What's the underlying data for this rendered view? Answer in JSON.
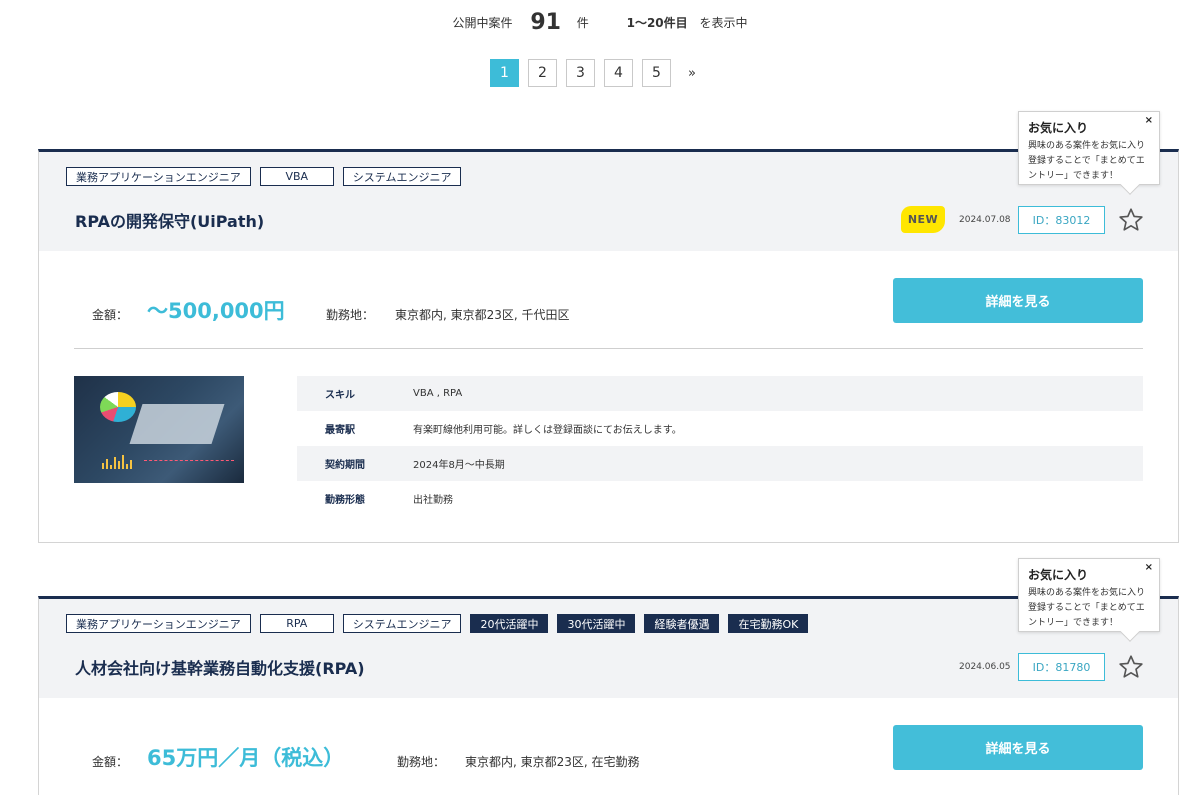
{
  "summary": {
    "prefix": "公開中案件",
    "count": "91",
    "unit": "件",
    "range": "1〜20件目",
    "suffix": "を表示中"
  },
  "pagination": {
    "pages": [
      "1",
      "2",
      "3",
      "4",
      "5"
    ],
    "current": "1",
    "next": "»"
  },
  "favorite_tooltip": {
    "title": "お気に入り",
    "body": "興味のある案件をお気に入り登録することで「まとめてエントリー」できます！",
    "close": "×"
  },
  "jobs": [
    {
      "tags": [
        "業務アプリケーションエンジニア",
        "VBA",
        "システムエンジニア"
      ],
      "dark_tags": [],
      "title": "RPAの開発保守(UiPath)",
      "new_badge": "NEW",
      "date": "2024.07.08",
      "id": "ID：83012",
      "price_label": "金額：",
      "price": "〜500,000円",
      "location_label": "勤務地：",
      "location": "東京都内, 東京都23区, 千代田区",
      "detail_button": "詳細を見る",
      "specs": [
        {
          "key": "スキル",
          "value": "VBA , RPA"
        },
        {
          "key": "最寄駅",
          "value": "有楽町線他利用可能。詳しくは登録面談にてお伝えします。"
        },
        {
          "key": "契約期間",
          "value": "2024年8月〜中長期"
        },
        {
          "key": "勤務形態",
          "value": "出社勤務"
        }
      ]
    },
    {
      "tags": [
        "業務アプリケーションエンジニア",
        "RPA",
        "システムエンジニア"
      ],
      "dark_tags": [
        "20代活躍中",
        "30代活躍中",
        "経験者優遇",
        "在宅勤務OK"
      ],
      "title": "人材会社向け基幹業務自動化支援(RPA)",
      "date": "2024.06.05",
      "id": "ID：81780",
      "price_label": "金額：",
      "price": "65万円／月（税込）",
      "location_label": "勤務地：",
      "location": "東京都内, 東京都23区, 在宅勤務",
      "detail_button": "詳細を見る"
    }
  ],
  "colors": {
    "navy": "#1a2d4f",
    "accent": "#3dbcd8",
    "new_badge": "#ffe600"
  }
}
